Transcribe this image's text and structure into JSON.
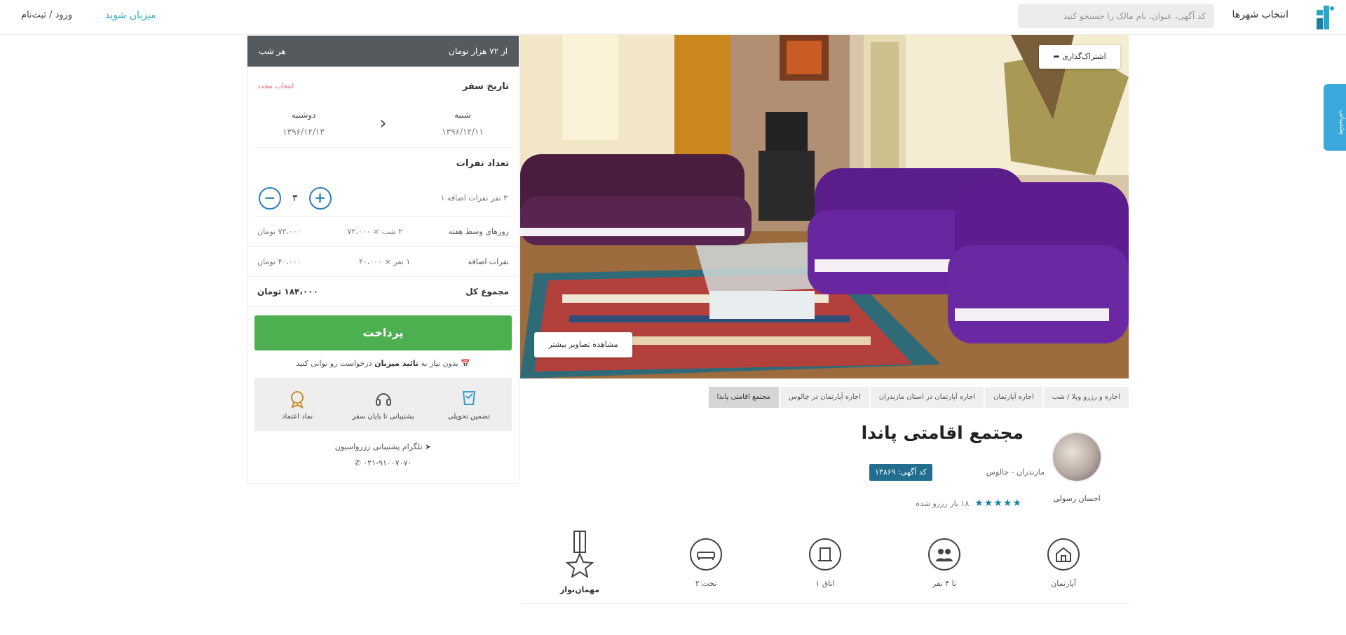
{
  "header": {
    "city_select": "انتخاب شهرها",
    "search_placeholder": "کد آگهی، عنوان، نام مالک را جستجو کنید",
    "host_link": "میزبان شوید",
    "login_link": "ورود / ثبت‌نام"
  },
  "side_tab": {
    "label": "پشتیبانی"
  },
  "booking": {
    "price_from": "از ۷۲ هزار تومان",
    "per_night": "هر شب",
    "travel_date_title": "تاریخ سفر",
    "clear_dates": "انتخاب مجدد",
    "checkin_day": "شنبه",
    "checkin_date": "۱۳۹۶/۱۲/۱۱",
    "checkout_day": "دوشنبه",
    "checkout_date": "۱۳۹۶/۱۲/۱۳",
    "guests_title": "تعداد نفرات",
    "guests_note": "۳ نفر نفرات اضافه ۱",
    "guests_count": "۳",
    "weekday_label": "روزهای وسط هفته",
    "weekday_calc": "۲ شب × ۷۲،۰۰۰",
    "weekday_total": "۷۲،۰۰۰ تومان",
    "extra_label": "نفرات اضافه",
    "extra_calc": "۱ نفر × ۴۰،۰۰۰",
    "extra_total": "۴۰،۰۰۰ تومان",
    "total_label": "مجموع کل",
    "total_value": "۱۸۴،۰۰۰ تومان",
    "pay_button": "پرداخت",
    "note_prefix": "بدون نیاز به",
    "note_bold": "تائید میزبان",
    "note_suffix": "درخواست رو توانی کنید",
    "features": [
      {
        "icon": "guarantee-icon",
        "label": "تضمین تحویلی"
      },
      {
        "icon": "headset-icon",
        "label": "پشتیبانی تا پایان سفر"
      },
      {
        "icon": "trust-badge-icon",
        "label": "نماد اعتماد"
      }
    ],
    "support_text": "تلگرام پشتیبانی رزرواسیون",
    "phone": "۰۲۱-۹۱۰۰۷۰۷۰"
  },
  "hero": {
    "share_button": "اشتراک‌گذاری",
    "view_photos_button": "مشاهده تصاویر بیشتر"
  },
  "breadcrumb": [
    "اجاره و رزرو ویلا / شب",
    "اجاره آپارتمان",
    "اجاره آپارتمان در استان مازندران",
    "اجاره آپارتمان در چالوس",
    "مجتمع اقامتی پاندا"
  ],
  "listing": {
    "title": "مجتمع اقامتی پاندا",
    "host_name": "احسان رسولی",
    "location": "مازندران - چالوس",
    "code": "کد آگهی: ۱۳۸۶۹",
    "rating_text": "۱۸ بار رزرو شده",
    "stars": "★★★★★"
  },
  "amenities": [
    {
      "icon": "house-icon",
      "label": "آپارتمان"
    },
    {
      "icon": "people-icon",
      "label": "تا ۴ نفر"
    },
    {
      "icon": "door-icon",
      "label": "۱ اتاق"
    },
    {
      "icon": "bed-icon",
      "label": "۲ تخت"
    },
    {
      "icon": "medal-icon",
      "label": "مهمان‌نواز"
    }
  ],
  "colors": {
    "accent": "#2aa6c8",
    "pay_green": "#4caf50",
    "price_bar": "#555a5f",
    "badge_blue": "#216e8f",
    "star_blue": "#1a7fa8"
  }
}
